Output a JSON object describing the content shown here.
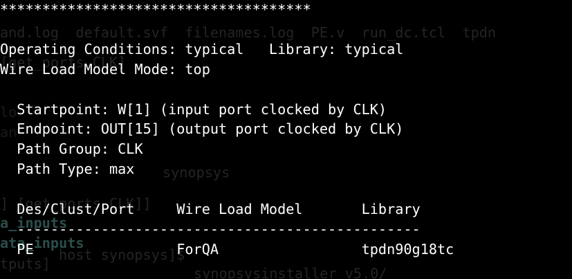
{
  "terminal": {
    "background_color": "#000000",
    "text_color": "#ffffff",
    "report_lines": [
      "*************************************",
      "",
      "Operating Conditions: typical   Library: typical",
      "Wire Load Model Mode: top",
      "",
      "  Startpoint: W[1] (input port clocked by CLK)",
      "  Endpoint: OUT[15] (output port clocked by CLK)",
      "  Path Group: CLK",
      "  Path Type: max",
      "",
      "  Des/Clust/Port     Wire Load Model       Library",
      "  ------------------------------------------------",
      "  PE                 ForQA                 tpdn90g18tc"
    ],
    "ghost_layer": {
      "files_line": "and.log  default.svf  filenames.log  PE.v  run_dc.tcl  tpdn",
      "get_ports_top": "[get_ports CLK]",
      "fragment_1": "synopsys",
      "fragment_2": "synopsys",
      "get_ports_bottom": "] [get_ports CLK]]",
      "a_inputs": "a_inputs",
      "data_inputs": "ata_inputs",
      "host_prompt": "host synopsys]$",
      "outputs": "tputs]",
      "installer": "synopsysinstaller_v5.0/"
    }
  }
}
